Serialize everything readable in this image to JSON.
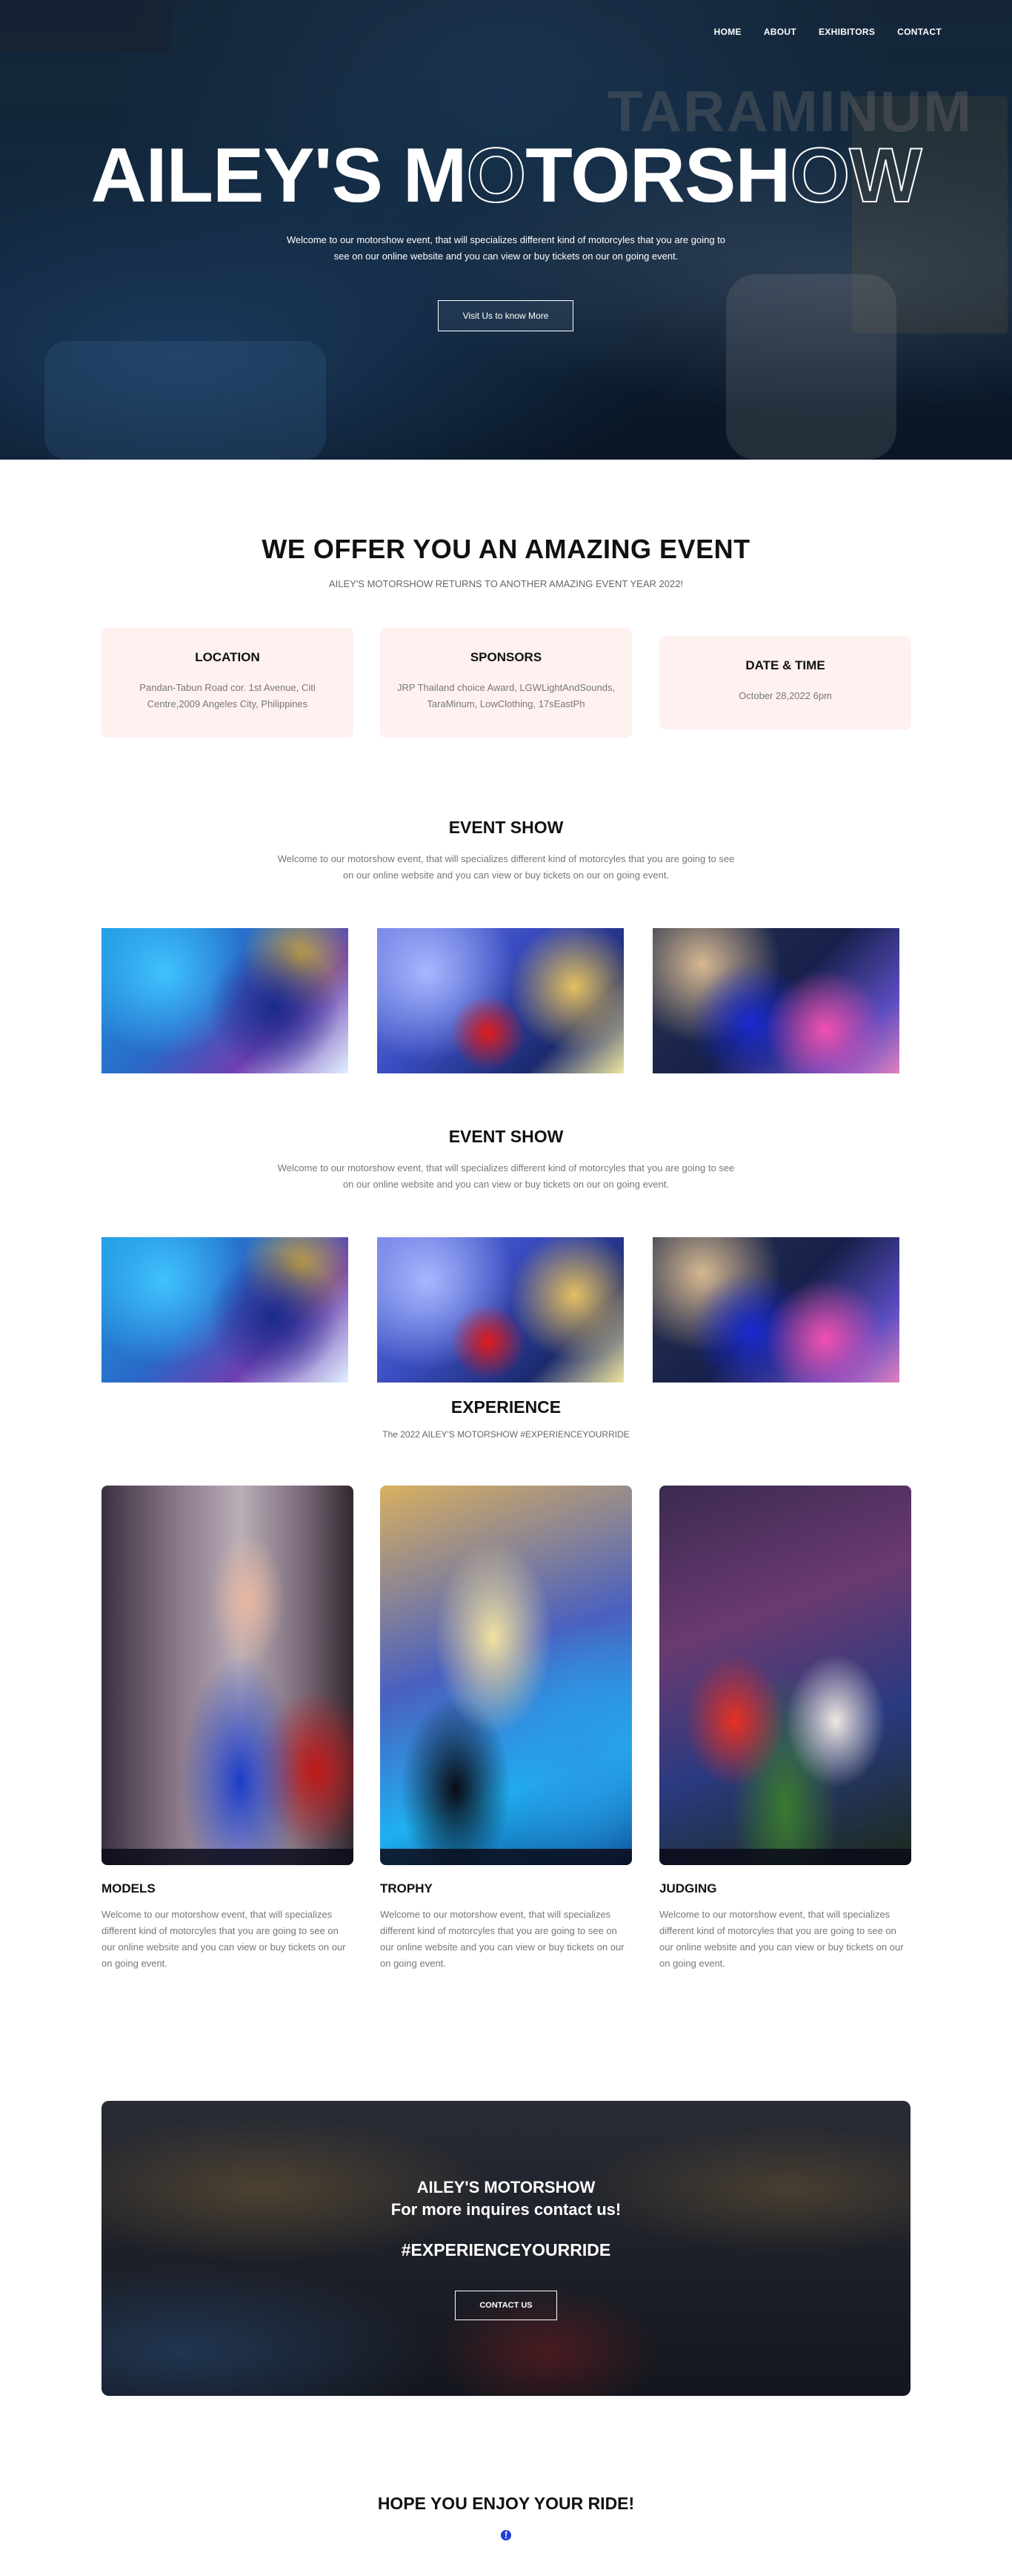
{
  "nav": {
    "items": [
      "HOME",
      "ABOUT",
      "EXHIBITORS",
      "CONTACT"
    ]
  },
  "hero": {
    "background_sign": "TARAMINUM",
    "title_solid_1": "AILEY'S M",
    "title_outline_1": "O",
    "title_solid_2": "TORSH",
    "title_outline_2": "OW",
    "title_full": "AILEY'S MOTORSHOW",
    "description": "Welcome to our motorshow event, that will specializes different kind of motorcyles that you are going to see on our online website and you can view or buy tickets on our on going event.",
    "button_label": "Visit Us to know More"
  },
  "offer": {
    "title": "WE OFFER YOU AN AMAZING EVENT",
    "subtitle": "AILEY'S MOTORSHOW RETURNS TO ANOTHER AMAZING EVENT YEAR 2022!",
    "cards": [
      {
        "title": "LOCATION",
        "text": "Pandan-Tabun Road cor. 1st Avenue, Citi Centre,2009 Angeles City, Philippines"
      },
      {
        "title": "SPONSORS",
        "text": "JRP Thailand choice Award, LGWLightAndSounds, TaraMinum, LowClothing, 17sEastPh"
      },
      {
        "title": "DATE & TIME",
        "text": "October 28,2022 6pm"
      }
    ]
  },
  "event_show_1": {
    "title": "EVENT SHOW",
    "description": "Welcome to our motorshow event, that will specializes different kind of motorcyles that you are going to see on our online website and you can view or buy tickets on our on going event."
  },
  "event_show_2": {
    "title": "EVENT SHOW",
    "description": "Welcome to our motorshow event, that will specializes different kind of motorcyles that you are going to see on our online website and you can view or buy tickets on our on going event."
  },
  "experience": {
    "title": "EXPERIENCE",
    "subtitle": "The 2022 AILEY'S MOTORSHOW #EXPERIENCEYOURRIDE",
    "items": [
      {
        "title": "MODELS",
        "text": "Welcome to our motorshow event, that will specializes different kind of motorcyles that you are going to see on our online website and you can view or buy tickets on our on going event."
      },
      {
        "title": "TROPHY",
        "text": "Welcome to our motorshow event, that will specializes different kind of motorcyles that you are going to see on our online website and you can view or buy tickets on our on going event."
      },
      {
        "title": "JUDGING",
        "text": "Welcome to our motorshow event, that will specializes different kind of motorcyles that you are going to see on our online website and you can view or buy tickets on our on going event."
      }
    ]
  },
  "cta": {
    "line1": "AILEY'S MOTORSHOW",
    "line2": "For more inquires contact us!",
    "tag": "#EXPERIENCEYOURRIDE",
    "button_label": "CONTACT US"
  },
  "footer": {
    "title": "HOPE YOU ENJOY YOUR RIDE!",
    "social_icon": "facebook-icon",
    "social_glyph": "f"
  },
  "colors": {
    "card_bg": "#fff1f0",
    "facebook": "#1a3fd6",
    "text_muted": "#777777"
  }
}
